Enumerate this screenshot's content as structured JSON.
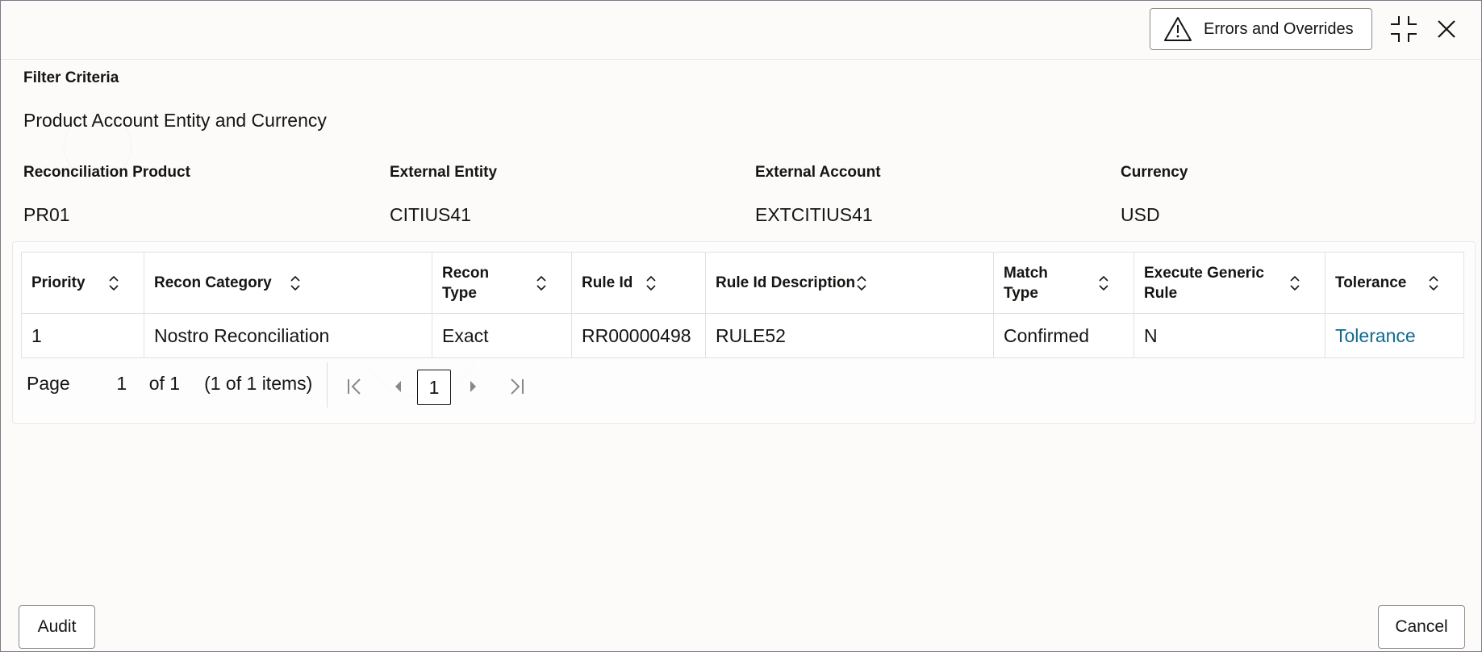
{
  "header": {
    "errors_button_label": "Errors and Overrides"
  },
  "filter": {
    "title": "Filter Criteria",
    "section_title": "Product Account Entity and Currency",
    "fields": [
      {
        "label": "Reconciliation Product",
        "value": "PR01"
      },
      {
        "label": "External Entity",
        "value": "CITIUS41"
      },
      {
        "label": "External Account",
        "value": "EXTCITIUS41"
      },
      {
        "label": "Currency",
        "value": "USD"
      }
    ]
  },
  "grid": {
    "columns": [
      {
        "label": "Priority"
      },
      {
        "label": "Recon Category"
      },
      {
        "label": "Recon Type"
      },
      {
        "label": "Rule Id"
      },
      {
        "label": "Rule Id Description"
      },
      {
        "label": "Match Type"
      },
      {
        "label": "Execute Generic Rule"
      },
      {
        "label": "Tolerance"
      }
    ],
    "rows": [
      {
        "priority": "1",
        "recon_category": "Nostro Reconciliation",
        "recon_type": "Exact",
        "rule_id": "RR00000498",
        "rule_id_description": "RULE52",
        "match_type": "Confirmed",
        "execute_generic_rule": "N",
        "tolerance": "Tolerance"
      }
    ]
  },
  "pagination": {
    "page_label": "Page",
    "current_page": "1",
    "of_label": "of 1",
    "items_label": "(1 of 1 items)",
    "page_button": "1"
  },
  "footer": {
    "audit_label": "Audit",
    "cancel_label": "Cancel"
  },
  "colors": {
    "link": "#0f6b8f",
    "border": "#8f8c87"
  }
}
